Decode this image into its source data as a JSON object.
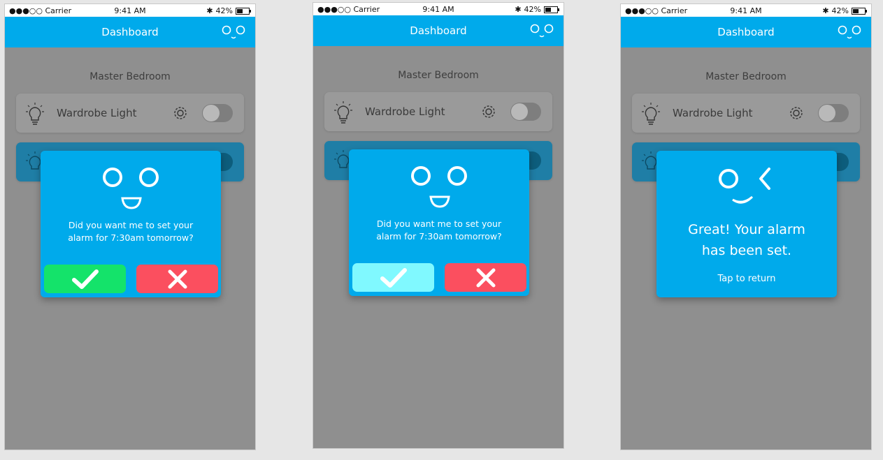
{
  "status": {
    "carrier": "●●●○○ Carrier",
    "time": "9:41 AM",
    "battery": "42%"
  },
  "header": {
    "title": "Dashboard"
  },
  "room": "Master Bedroom",
  "devices": [
    {
      "label": "Wardrobe Light"
    }
  ],
  "confirm_dialog": {
    "message_line1": "Did you want me to set your",
    "message_line2": "alarm for 7:30am tomorrow?",
    "yes_icon": "checkmark-icon",
    "no_icon": "close-icon"
  },
  "done_dialog": {
    "line1": "Great! Your alarm",
    "line2": "has been set.",
    "tap_label": "Tap to return"
  },
  "colors": {
    "accent": "#00aaeb",
    "yes": "#14e36a",
    "yes_pressed": "#80f9ff",
    "no": "#fb4f5f"
  }
}
